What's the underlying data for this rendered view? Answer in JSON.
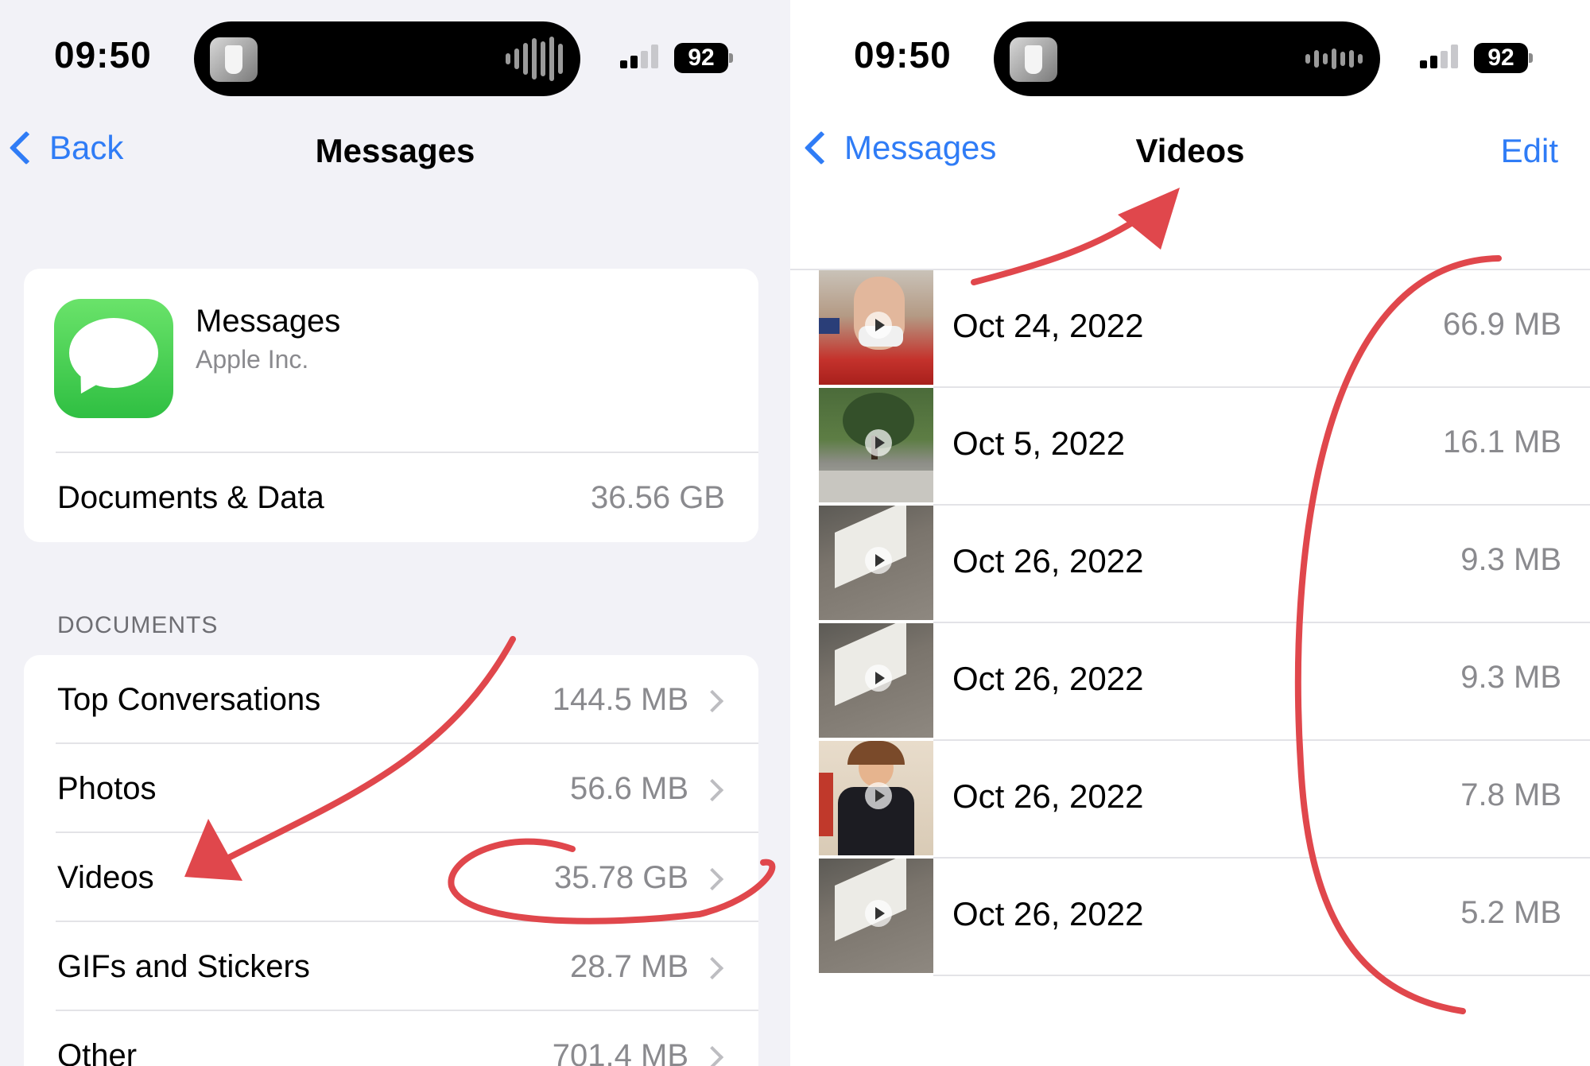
{
  "left": {
    "status": {
      "time": "09:50",
      "battery": "92"
    },
    "nav": {
      "back_label": "Back",
      "title": "Messages"
    },
    "app": {
      "name": "Messages",
      "developer": "Apple Inc."
    },
    "docs_data": {
      "label": "Documents & Data",
      "value": "36.56 GB"
    },
    "section_header": "DOCUMENTS",
    "rows": [
      {
        "label": "Top Conversations",
        "value": "144.5 MB"
      },
      {
        "label": "Photos",
        "value": "56.6 MB"
      },
      {
        "label": "Videos",
        "value": "35.78 GB"
      },
      {
        "label": "GIFs and Stickers",
        "value": "28.7 MB"
      },
      {
        "label": "Other",
        "value": "701.4 MB"
      }
    ]
  },
  "right": {
    "status": {
      "time": "09:50",
      "battery": "92"
    },
    "nav": {
      "back_label": "Messages",
      "title": "Videos",
      "edit_label": "Edit"
    },
    "videos": [
      {
        "date": "Oct 24, 2022",
        "size": "66.9 MB",
        "thumb": "selfie-with-mask"
      },
      {
        "date": "Oct 5, 2022",
        "size": "16.1 MB",
        "thumb": "garden-tree"
      },
      {
        "date": "Oct 26, 2022",
        "size": "9.3 MB",
        "thumb": "deck-railing"
      },
      {
        "date": "Oct 26, 2022",
        "size": "9.3 MB",
        "thumb": "deck-railing"
      },
      {
        "date": "Oct 26, 2022",
        "size": "7.8 MB",
        "thumb": "child-halloween-shirt"
      },
      {
        "date": "Oct 26, 2022",
        "size": "5.2 MB",
        "thumb": "deck-railing"
      }
    ]
  },
  "annotation_color": "#e0474c",
  "accent": "#2f7cf6"
}
